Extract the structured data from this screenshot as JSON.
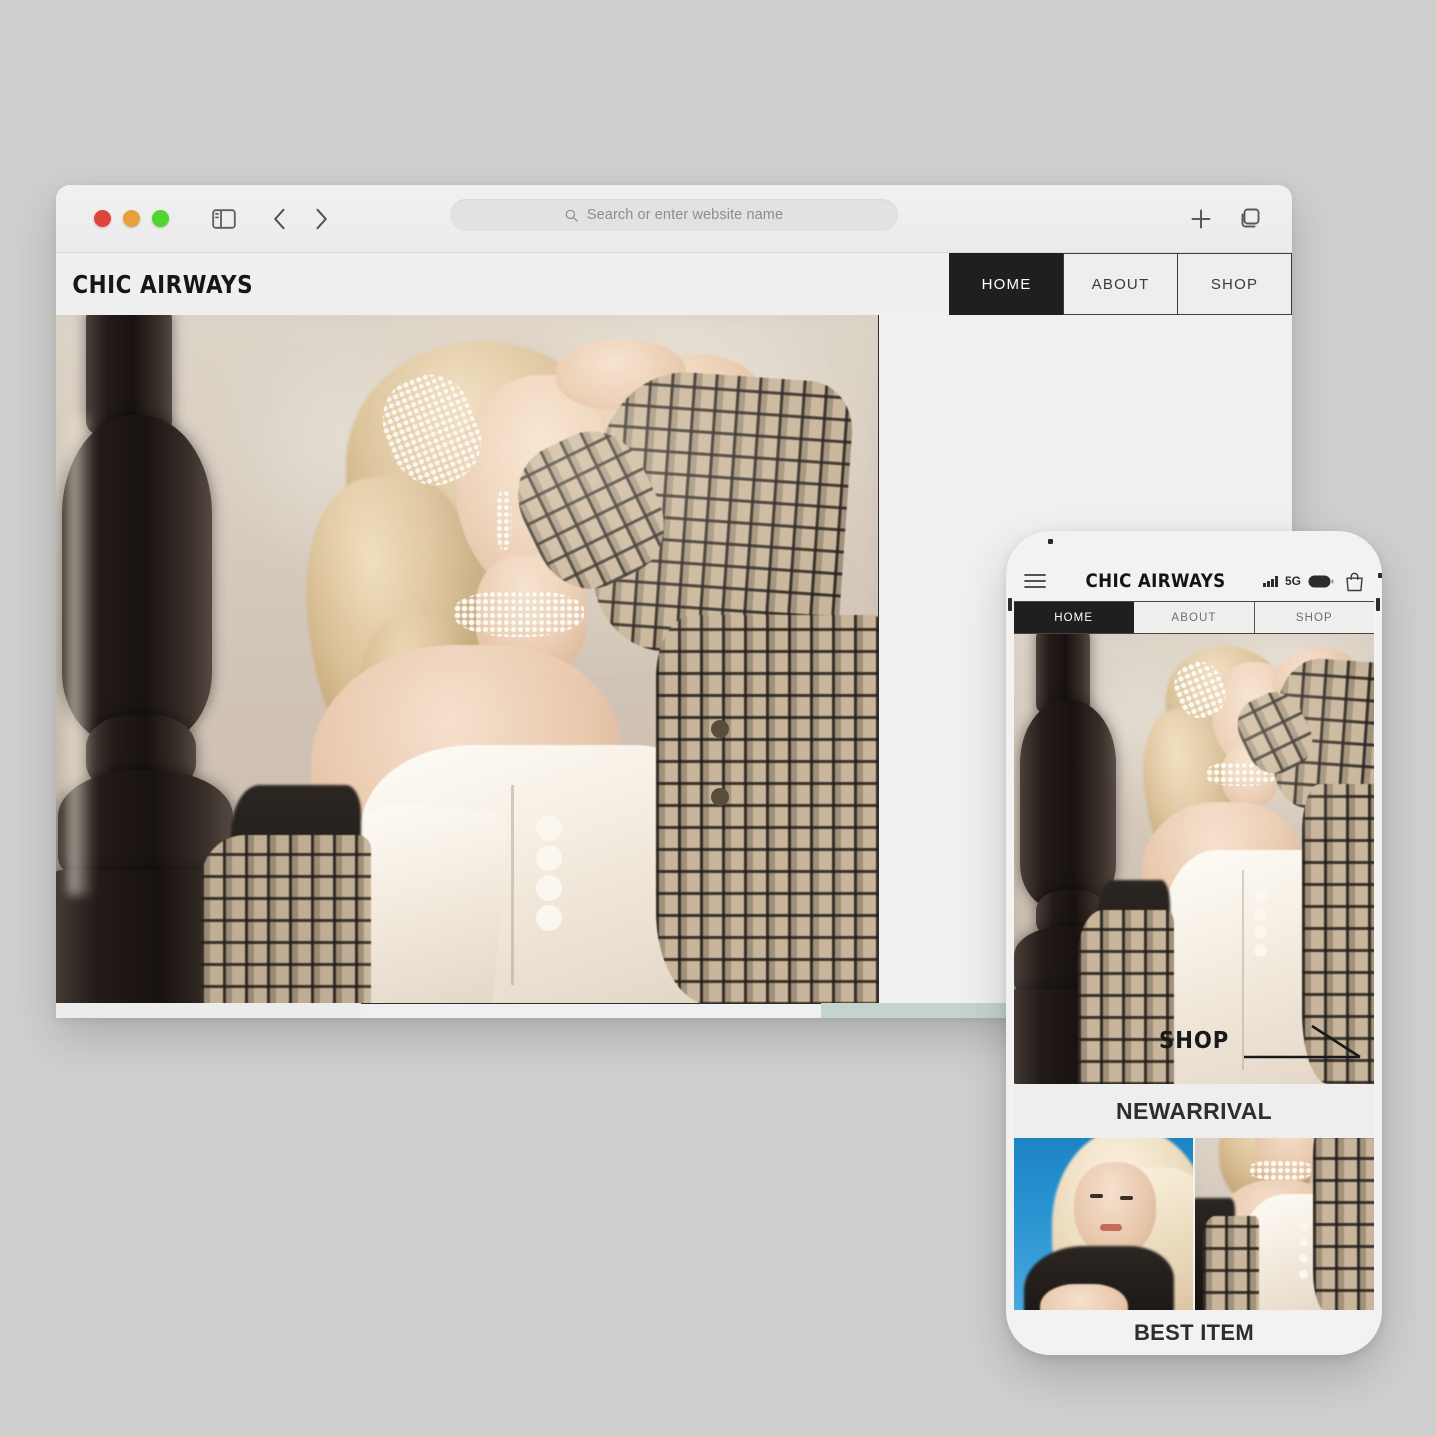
{
  "browser": {
    "traffic_lights": [
      {
        "name": "close",
        "color": "#e0453c"
      },
      {
        "name": "minimize",
        "color": "#e8a03c"
      },
      {
        "name": "maximize",
        "color": "#4fd62e"
      }
    ],
    "sidebar_icon": "sidebar-icon",
    "back_icon": "chevron-left-icon",
    "forward_icon": "chevron-right-icon",
    "address_bar": {
      "search_icon": "search-icon",
      "placeholder": "Search or enter website name",
      "value": ""
    },
    "new_tab_icon": "plus-icon",
    "tab_overview_icon": "tab-overview-icon"
  },
  "site": {
    "logo": "CHIC AIRWAYS",
    "nav": [
      {
        "label": "HOME",
        "active": true
      },
      {
        "label": "ABOUT",
        "active": false
      },
      {
        "label": "SHOP",
        "active": false
      }
    ]
  },
  "phone": {
    "menu_icon": "hamburger-menu-icon",
    "brand": "CHIC AIRWAYS",
    "status": {
      "signal_icon": "signal-bars-icon",
      "network": "5G",
      "battery_icon": "battery-icon",
      "bag_icon": "shopping-bag-icon"
    },
    "nav": [
      {
        "label": "HOME",
        "active": true
      },
      {
        "label": "ABOUT",
        "active": false
      },
      {
        "label": "SHOP",
        "active": false
      }
    ],
    "hero_cta": {
      "label": "SHOP",
      "arrow_icon": "arrow-right-icon"
    },
    "sections": [
      {
        "title": "NEWARRIVAL"
      },
      {
        "title": "BEST ITEM"
      }
    ]
  },
  "colors": {
    "page_background": "#cfcfcf",
    "chrome": "#ececec",
    "nav_active": "#1f1f1f",
    "text_dark": "#1a1a1a",
    "text_muted": "#6e6e6e"
  }
}
